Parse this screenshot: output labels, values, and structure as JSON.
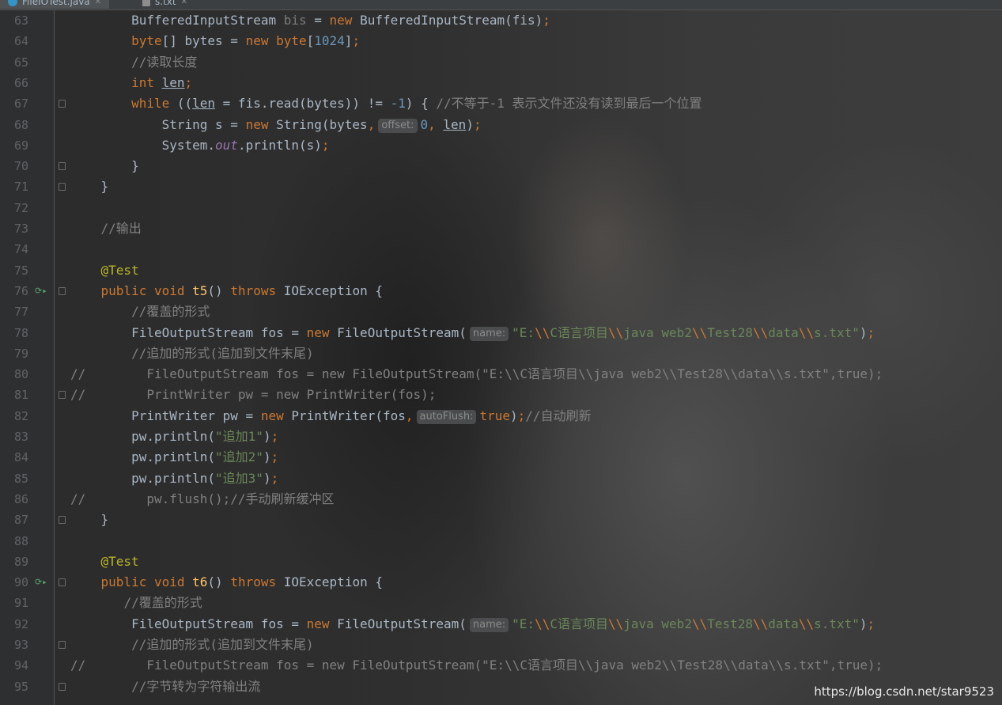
{
  "tabs": [
    {
      "label": "FileIOTest.java",
      "icon": "java-class-icon",
      "active": true
    },
    {
      "label": "s.txt",
      "icon": "text-file-icon",
      "active": false
    }
  ],
  "lines": [
    {
      "n": "63",
      "tokens": [
        [
          "        ",
          ""
        ],
        [
          "BufferedInputStream ",
          ""
        ],
        [
          "bis",
          "dim"
        ],
        [
          " = ",
          ""
        ],
        [
          "new ",
          "kw"
        ],
        [
          "BufferedInputStream(fis)",
          ""
        ],
        [
          ";",
          "kw"
        ]
      ]
    },
    {
      "n": "64",
      "tokens": [
        [
          "        ",
          ""
        ],
        [
          "byte",
          "kw"
        ],
        [
          "[] bytes = ",
          ""
        ],
        [
          "new ",
          "kw"
        ],
        [
          "byte",
          "kw"
        ],
        [
          "[",
          ""
        ],
        [
          "1024",
          "num"
        ],
        [
          "]",
          ""
        ],
        [
          ";",
          "kw"
        ]
      ]
    },
    {
      "n": "65",
      "tokens": [
        [
          "        ",
          ""
        ],
        [
          "//读取长度",
          "cm"
        ]
      ]
    },
    {
      "n": "66",
      "tokens": [
        [
          "        ",
          ""
        ],
        [
          "int ",
          "kw"
        ],
        [
          "len",
          "und"
        ],
        [
          ";",
          "kw"
        ]
      ]
    },
    {
      "n": "67",
      "fold": true,
      "tokens": [
        [
          "        ",
          ""
        ],
        [
          "while ",
          "kw"
        ],
        [
          "((",
          ""
        ],
        [
          "len",
          "und"
        ],
        [
          " = fis.read(bytes)) != ",
          ""
        ],
        [
          "-1",
          "num"
        ],
        [
          ") { ",
          ""
        ],
        [
          "//不等于-1 表示文件还没有读到最后一个位置",
          "cm"
        ]
      ]
    },
    {
      "n": "68",
      "tokens": [
        [
          "            ",
          ""
        ],
        [
          "String s = ",
          ""
        ],
        [
          "new ",
          "kw"
        ],
        [
          "String(bytes",
          ""
        ],
        [
          ",",
          "kw"
        ],
        [
          "HINT:offset:",
          ""
        ],
        [
          "0",
          "num"
        ],
        [
          ", ",
          "kw"
        ],
        [
          "len",
          "und"
        ],
        [
          ")",
          ""
        ],
        [
          ";",
          "kw"
        ]
      ]
    },
    {
      "n": "69",
      "tokens": [
        [
          "            ",
          ""
        ],
        [
          "System.",
          ""
        ],
        [
          "out",
          "sf"
        ],
        [
          ".println(s)",
          ""
        ],
        [
          ";",
          "kw"
        ]
      ]
    },
    {
      "n": "70",
      "fold": true,
      "tokens": [
        [
          "        ",
          ""
        ],
        [
          "}",
          ""
        ]
      ]
    },
    {
      "n": "71",
      "fold": true,
      "tokens": [
        [
          "    ",
          ""
        ],
        [
          "}",
          ""
        ]
      ]
    },
    {
      "n": "72",
      "tokens": []
    },
    {
      "n": "73",
      "tokens": [
        [
          "    ",
          ""
        ],
        [
          "//输出",
          "cm"
        ]
      ]
    },
    {
      "n": "74",
      "tokens": []
    },
    {
      "n": "75",
      "tokens": [
        [
          "    ",
          ""
        ],
        [
          "@Test",
          "ann"
        ]
      ]
    },
    {
      "n": "76",
      "run": true,
      "fold": true,
      "tokens": [
        [
          "    ",
          ""
        ],
        [
          "public ",
          "kw"
        ],
        [
          "void ",
          "kw"
        ],
        [
          "t5",
          "fn"
        ],
        [
          "() ",
          ""
        ],
        [
          "throws ",
          "kw"
        ],
        [
          "IOException {",
          ""
        ]
      ]
    },
    {
      "n": "77",
      "tokens": [
        [
          "        ",
          ""
        ],
        [
          "//覆盖的形式",
          "cm"
        ]
      ]
    },
    {
      "n": "78",
      "tokens": [
        [
          "        ",
          ""
        ],
        [
          "FileOutputStream fos = ",
          ""
        ],
        [
          "new ",
          "kw"
        ],
        [
          "FileOutputStream(",
          ""
        ],
        [
          "HINT:name:",
          ""
        ],
        [
          "\"E:",
          "str"
        ],
        [
          "\\\\",
          "kw"
        ],
        [
          "C语言项目",
          "str"
        ],
        [
          "\\\\",
          "kw"
        ],
        [
          "java web2",
          "str"
        ],
        [
          "\\\\",
          "kw"
        ],
        [
          "Test28",
          "str"
        ],
        [
          "\\\\",
          "kw"
        ],
        [
          "data",
          "str"
        ],
        [
          "\\\\",
          "kw"
        ],
        [
          "s.txt\"",
          "str"
        ],
        [
          ")",
          ""
        ],
        [
          ";",
          "kw"
        ]
      ]
    },
    {
      "n": "79",
      "tokens": [
        [
          "        ",
          ""
        ],
        [
          "//追加的形式(追加到文件末尾)",
          "cm"
        ]
      ]
    },
    {
      "n": "80",
      "tokens": [
        [
          "//",
          "cm"
        ],
        [
          "        FileOutputStream fos = new FileOutputStream(\"E:\\\\C语言项目\\\\java web2\\\\Test28\\\\data\\\\s.txt\",true);",
          "cm"
        ]
      ]
    },
    {
      "n": "81",
      "fold": true,
      "tokens": [
        [
          "//",
          "cm"
        ],
        [
          "        PrintWriter pw = new PrintWriter(fos);",
          "cm"
        ]
      ]
    },
    {
      "n": "82",
      "tokens": [
        [
          "        ",
          ""
        ],
        [
          "PrintWriter pw = ",
          ""
        ],
        [
          "new ",
          "kw"
        ],
        [
          "PrintWriter(fos",
          ""
        ],
        [
          ",",
          "kw"
        ],
        [
          "HINT:autoFlush:",
          ""
        ],
        [
          "true",
          "kw"
        ],
        [
          ")",
          ""
        ],
        [
          ";",
          "kw"
        ],
        [
          "//自动刷新",
          "cm"
        ]
      ]
    },
    {
      "n": "83",
      "tokens": [
        [
          "        ",
          ""
        ],
        [
          "pw.println(",
          ""
        ],
        [
          "\"追加1\"",
          "str"
        ],
        [
          ")",
          ""
        ],
        [
          ";",
          "kw"
        ]
      ]
    },
    {
      "n": "84",
      "tokens": [
        [
          "        ",
          ""
        ],
        [
          "pw.println(",
          ""
        ],
        [
          "\"追加2\"",
          "str"
        ],
        [
          ")",
          ""
        ],
        [
          ";",
          "kw"
        ]
      ]
    },
    {
      "n": "85",
      "tokens": [
        [
          "        ",
          ""
        ],
        [
          "pw.println(",
          ""
        ],
        [
          "\"追加3\"",
          "str"
        ],
        [
          ")",
          ""
        ],
        [
          ";",
          "kw"
        ]
      ]
    },
    {
      "n": "86",
      "tokens": [
        [
          "//",
          "cm"
        ],
        [
          "        pw.flush();//手动刷新缓冲区",
          "cm"
        ]
      ]
    },
    {
      "n": "87",
      "fold": true,
      "tokens": [
        [
          "    ",
          ""
        ],
        [
          "}",
          ""
        ]
      ]
    },
    {
      "n": "88",
      "tokens": []
    },
    {
      "n": "89",
      "tokens": [
        [
          "    ",
          ""
        ],
        [
          "@Test",
          "ann"
        ]
      ]
    },
    {
      "n": "90",
      "run": true,
      "fold": true,
      "tokens": [
        [
          "    ",
          ""
        ],
        [
          "public ",
          "kw"
        ],
        [
          "void ",
          "kw"
        ],
        [
          "t6",
          "fn"
        ],
        [
          "() ",
          ""
        ],
        [
          "throws ",
          "kw"
        ],
        [
          "IOException {",
          ""
        ]
      ]
    },
    {
      "n": "91",
      "tokens": [
        [
          "       ",
          ""
        ],
        [
          "//覆盖的形式",
          "cm"
        ]
      ]
    },
    {
      "n": "92",
      "tokens": [
        [
          "        ",
          ""
        ],
        [
          "FileOutputStream fos = ",
          ""
        ],
        [
          "new ",
          "kw"
        ],
        [
          "FileOutputStream(",
          ""
        ],
        [
          "HINT:name:",
          ""
        ],
        [
          "\"E:",
          "str"
        ],
        [
          "\\\\",
          "kw"
        ],
        [
          "C语言项目",
          "str"
        ],
        [
          "\\\\",
          "kw"
        ],
        [
          "java web2",
          "str"
        ],
        [
          "\\\\",
          "kw"
        ],
        [
          "Test28",
          "str"
        ],
        [
          "\\\\",
          "kw"
        ],
        [
          "data",
          "str"
        ],
        [
          "\\\\",
          "kw"
        ],
        [
          "s.txt\"",
          "str"
        ],
        [
          ")",
          ""
        ],
        [
          ";",
          "kw"
        ]
      ]
    },
    {
      "n": "93",
      "fold": true,
      "tokens": [
        [
          "        ",
          ""
        ],
        [
          "//追加的形式(追加到文件末尾)",
          "cm"
        ]
      ]
    },
    {
      "n": "94",
      "tokens": [
        [
          "//",
          "cm"
        ],
        [
          "        FileOutputStream fos = new FileOutputStream(\"E:\\\\C语言项目\\\\java web2\\\\Test28\\\\data\\\\s.txt\",true);",
          "cm"
        ]
      ]
    },
    {
      "n": "95",
      "fold": true,
      "tokens": [
        [
          "        ",
          ""
        ],
        [
          "//字节转为字符输出流",
          "cm"
        ]
      ]
    }
  ],
  "watermark": "https://blog.csdn.net/star9523",
  "colors": {
    "background": "#2b2b2b",
    "keyword": "#cc7832",
    "comment": "#808080",
    "number": "#6897bb",
    "string": "#6a8759",
    "annotation": "#bbb529",
    "method": "#ffc66d",
    "static_field": "#9876aa",
    "run_icon": "#59a869"
  }
}
